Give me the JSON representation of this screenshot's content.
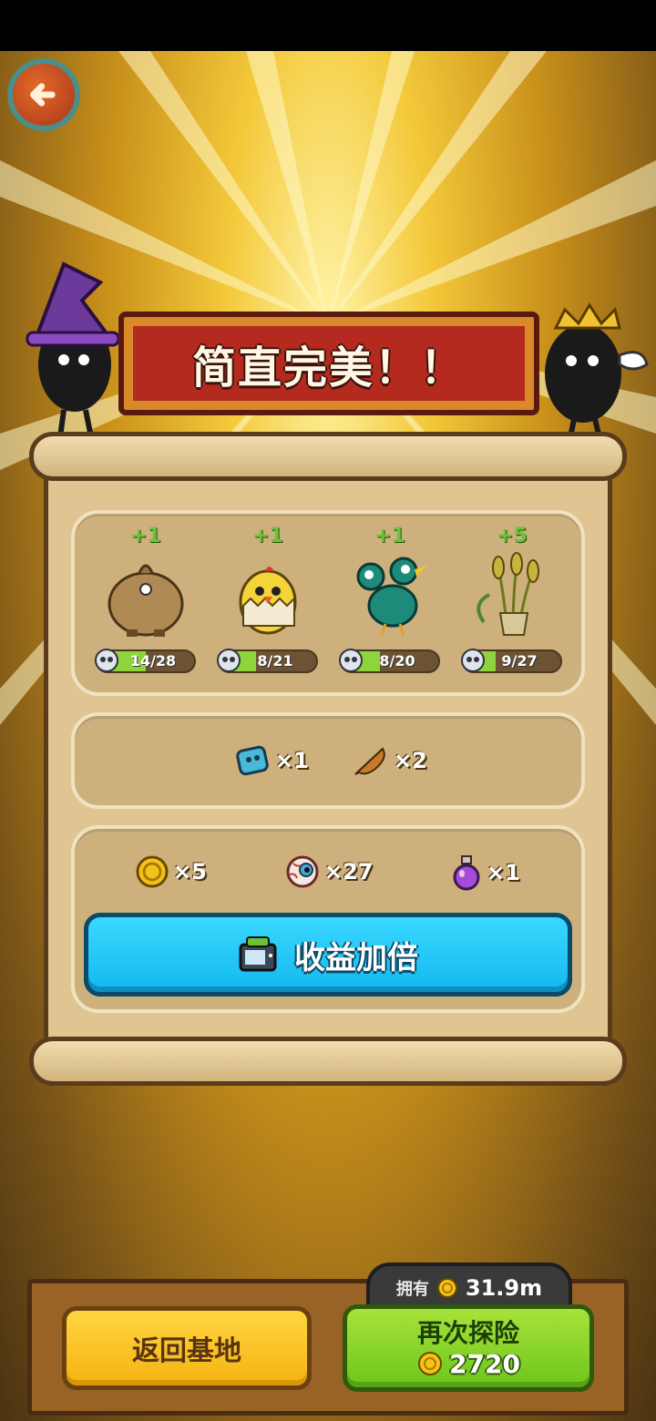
{
  "banner": {
    "title": "简直完美！！"
  },
  "monsters": [
    {
      "name": "sack-monster",
      "bonus": "+1",
      "progress": "14/28",
      "fill": 0.5
    },
    {
      "name": "chick-monster",
      "bonus": "+1",
      "progress": "8/21",
      "fill": 0.38
    },
    {
      "name": "bird-monster",
      "bonus": "+1",
      "progress": "8/20",
      "fill": 0.4
    },
    {
      "name": "wheat-monster",
      "bonus": "+5",
      "progress": "9/27",
      "fill": 0.33
    }
  ],
  "materials": [
    {
      "icon": "blue-gem-icon",
      "count": "×1"
    },
    {
      "icon": "feather-icon",
      "count": "×2"
    }
  ],
  "rewards": [
    {
      "icon": "gold-coin-icon",
      "count": "×5"
    },
    {
      "icon": "eyeball-icon",
      "count": "×27"
    },
    {
      "icon": "potion-icon",
      "count": "×1"
    }
  ],
  "double_button": {
    "label": "收益加倍",
    "icon": "video-ad-icon"
  },
  "owned": {
    "label": "拥有",
    "value": "31.9m"
  },
  "return_button": {
    "label": "返回基地"
  },
  "explore_button": {
    "label": "再次探险",
    "cost": "2720"
  },
  "colors": {
    "accent_blue": "#12b8ee",
    "accent_green": "#6ec51b",
    "accent_yellow": "#f5b211",
    "banner_red": "#b52a1e"
  }
}
